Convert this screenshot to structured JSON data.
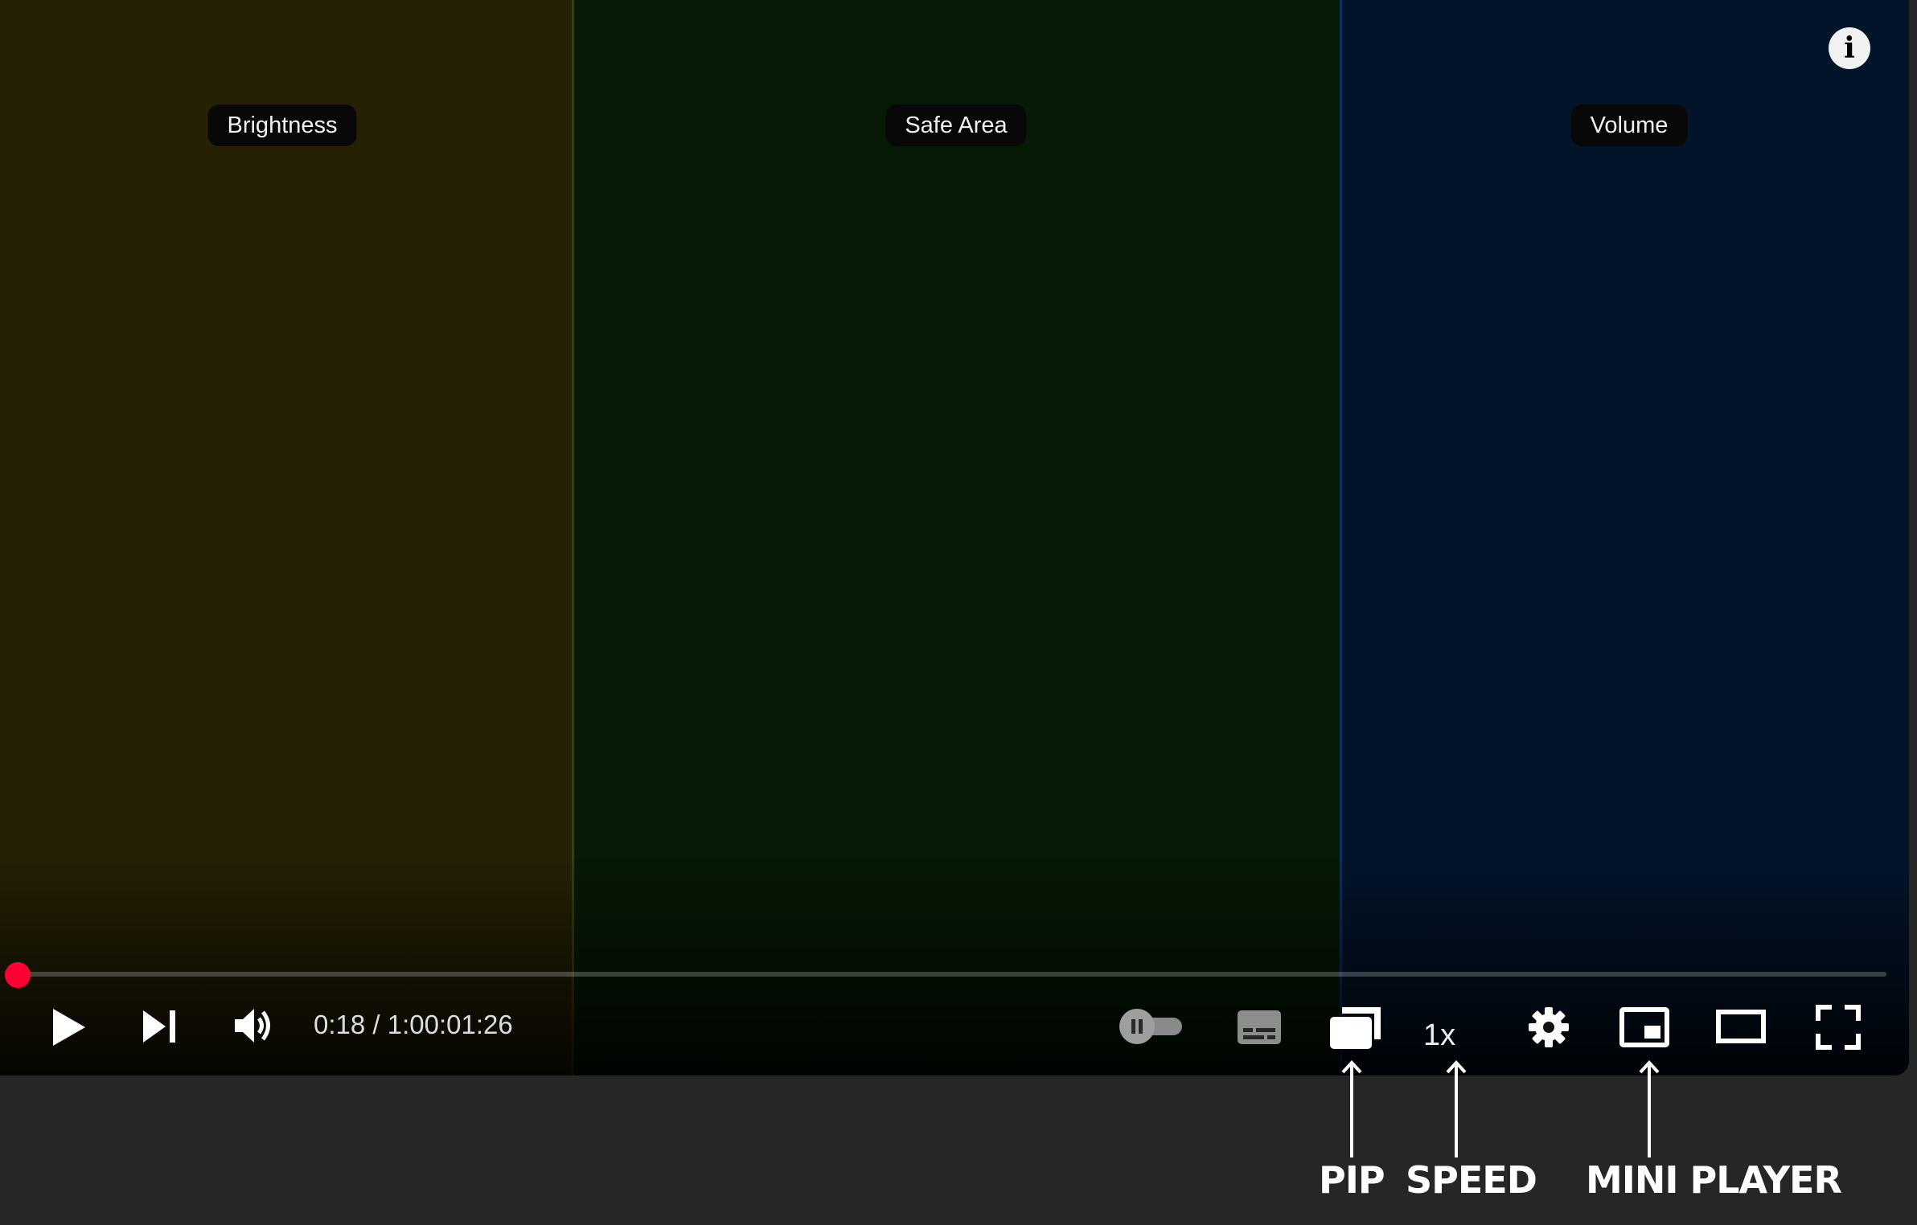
{
  "zones": {
    "brightness": {
      "label": "Brightness",
      "color": "#262005"
    },
    "safe_area": {
      "label": "Safe Area",
      "color": "#061a05"
    },
    "volume": {
      "label": "Volume",
      "color": "#02142a"
    }
  },
  "icons": {
    "info": "info-icon",
    "play": "play-icon",
    "next": "skip-next-icon",
    "volume": "volume-icon",
    "autoplay": "autoplay-toggle-icon",
    "subtitles": "subtitles-icon",
    "pip": "picture-in-picture-icon",
    "settings": "gear-icon",
    "miniplayer": "miniplayer-icon",
    "theater": "theater-mode-icon",
    "fullscreen": "fullscreen-icon"
  },
  "info_glyph": "i",
  "player": {
    "time": "0:18 / 1:00:01:26",
    "progress_fraction": 0.005,
    "progress_color": "#ff0033",
    "speed_label": "1x",
    "autoplay": "off"
  },
  "annotations": {
    "pip": "PIP",
    "speed": "SPEED",
    "mini_player": "MINI PLAYER"
  }
}
